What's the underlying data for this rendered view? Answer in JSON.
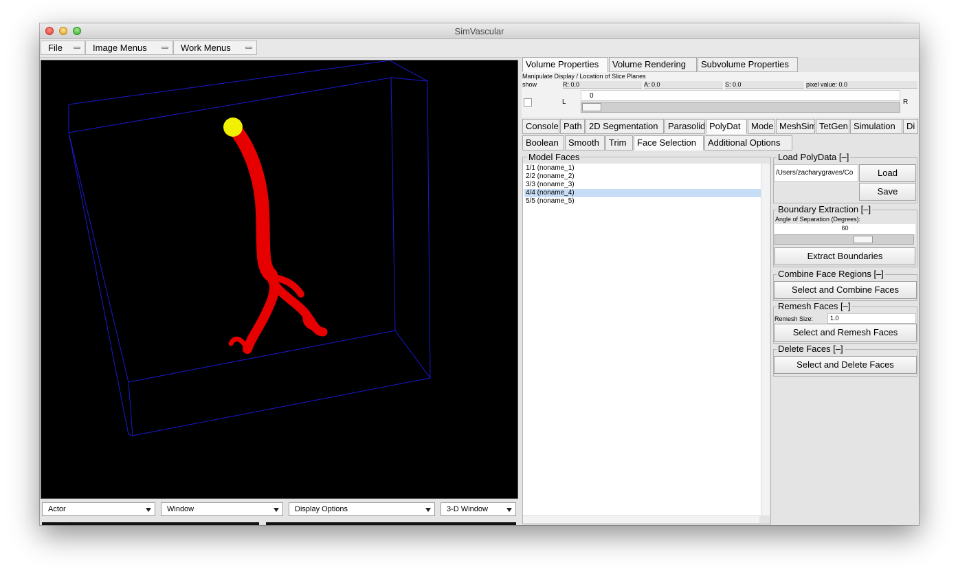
{
  "window": {
    "title": "SimVascular"
  },
  "menubar": {
    "file": "File",
    "image_menus": "Image Menus",
    "work_menus": "Work Menus"
  },
  "viewer_controls": {
    "actor": "Actor",
    "window": "Window",
    "display_options": "Display Options",
    "window_3d": "3-D Window"
  },
  "volume_tabs": {
    "volume_properties": "Volume Properties",
    "volume_rendering": "Volume Rendering",
    "subvolume_properties": "Subvolume Properties"
  },
  "slice_panel": {
    "heading": "Manipulate Display / Location of Slice Planes",
    "show": "show",
    "r": "R: 0.0",
    "a": "A: 0.0",
    "s": "S: 0.0",
    "pixel_value": "pixel value: 0.0",
    "slider_value": "0",
    "left_label": "L",
    "right_label": "R"
  },
  "main_tabs": [
    "Console",
    "Path",
    "2D Segmentation",
    "Parasolid",
    "PolyDat",
    "Mode",
    "MeshSim",
    "TetGen",
    "Simulation",
    "Di"
  ],
  "poly_tabs": [
    "Boolean",
    "Smooth",
    "Trim",
    "Face Selection",
    "Additional Options"
  ],
  "model_faces": {
    "title": "Model Faces",
    "items": [
      "1/1 (noname_1)",
      "2/2 (noname_2)",
      "3/3 (noname_3)",
      "4/4 (noname_4)",
      "5/5 (noname_5)"
    ],
    "selected_index": 3
  },
  "load_polydata": {
    "title": "Load PolyData [–]",
    "path": "/Users/zacharygraves/Co",
    "load": "Load",
    "save": "Save"
  },
  "boundary_extraction": {
    "title": "Boundary Extraction [–]",
    "angle_label": "Angle of Separation (Degrees):",
    "angle_value": "60",
    "extract": "Extract Boundaries"
  },
  "combine_faces": {
    "title": "Combine Face Regions [–]",
    "button": "Select and Combine Faces"
  },
  "remesh_faces": {
    "title": "Remesh Faces [–]",
    "size_label": "Remesh Size:",
    "size_value": "1.0",
    "button": "Select and Remesh Faces"
  },
  "delete_faces": {
    "title": "Delete Faces [–]",
    "button": "Select and Delete Faces"
  },
  "colors": {
    "vessel": "#e60000",
    "endpoint": "#f0f000",
    "bounding_box": "#1a1ad0"
  }
}
